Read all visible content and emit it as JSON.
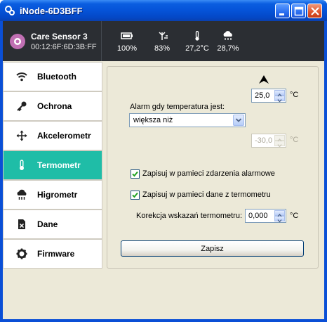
{
  "window": {
    "title": "iNode-6D3BFF"
  },
  "device": {
    "name": "Care Sensor 3",
    "mac": "00:12:6F:6D:3B:FF"
  },
  "status": {
    "battery": "100%",
    "signal": "83%",
    "temperature": "27,2°C",
    "humidity": "28,7%"
  },
  "nav": {
    "items": [
      {
        "label": "Bluetooth",
        "icon": "wifi-icon",
        "active": false
      },
      {
        "label": "Ochrona",
        "icon": "key-icon",
        "active": false
      },
      {
        "label": "Akcelerometr",
        "icon": "move-arrows-icon",
        "active": false
      },
      {
        "label": "Termometr",
        "icon": "thermometer-icon",
        "active": true
      },
      {
        "label": "Higrometr",
        "icon": "cloud-rain-icon",
        "active": false
      },
      {
        "label": "Dane",
        "icon": "file-delete-icon",
        "active": false
      },
      {
        "label": "Firmware",
        "icon": "gear-icon",
        "active": false
      }
    ]
  },
  "thermometer": {
    "upper_value": "25,0",
    "upper_unit": "°C",
    "alarm_label": "Alarm gdy temperatura jest:",
    "alarm_condition": "większa niż",
    "lower_value": "-30,0",
    "lower_unit": "°C",
    "save_alarm_events_label": "Zapisuj w pamieci zdarzenia alarmowe",
    "save_alarm_events_checked": true,
    "save_thermo_data_label": "Zapisuj w pamieci dane z termometru",
    "save_thermo_data_checked": true,
    "correction_label": "Korekcja wskazań termometru:",
    "correction_value": "0,000",
    "correction_unit": "°C",
    "save_button": "Zapisz"
  },
  "colors": {
    "titlebar": "#0553d8",
    "header_bg": "#2b2e33",
    "active_nav": "#1fbda7",
    "window_bg": "#ece9d8"
  }
}
